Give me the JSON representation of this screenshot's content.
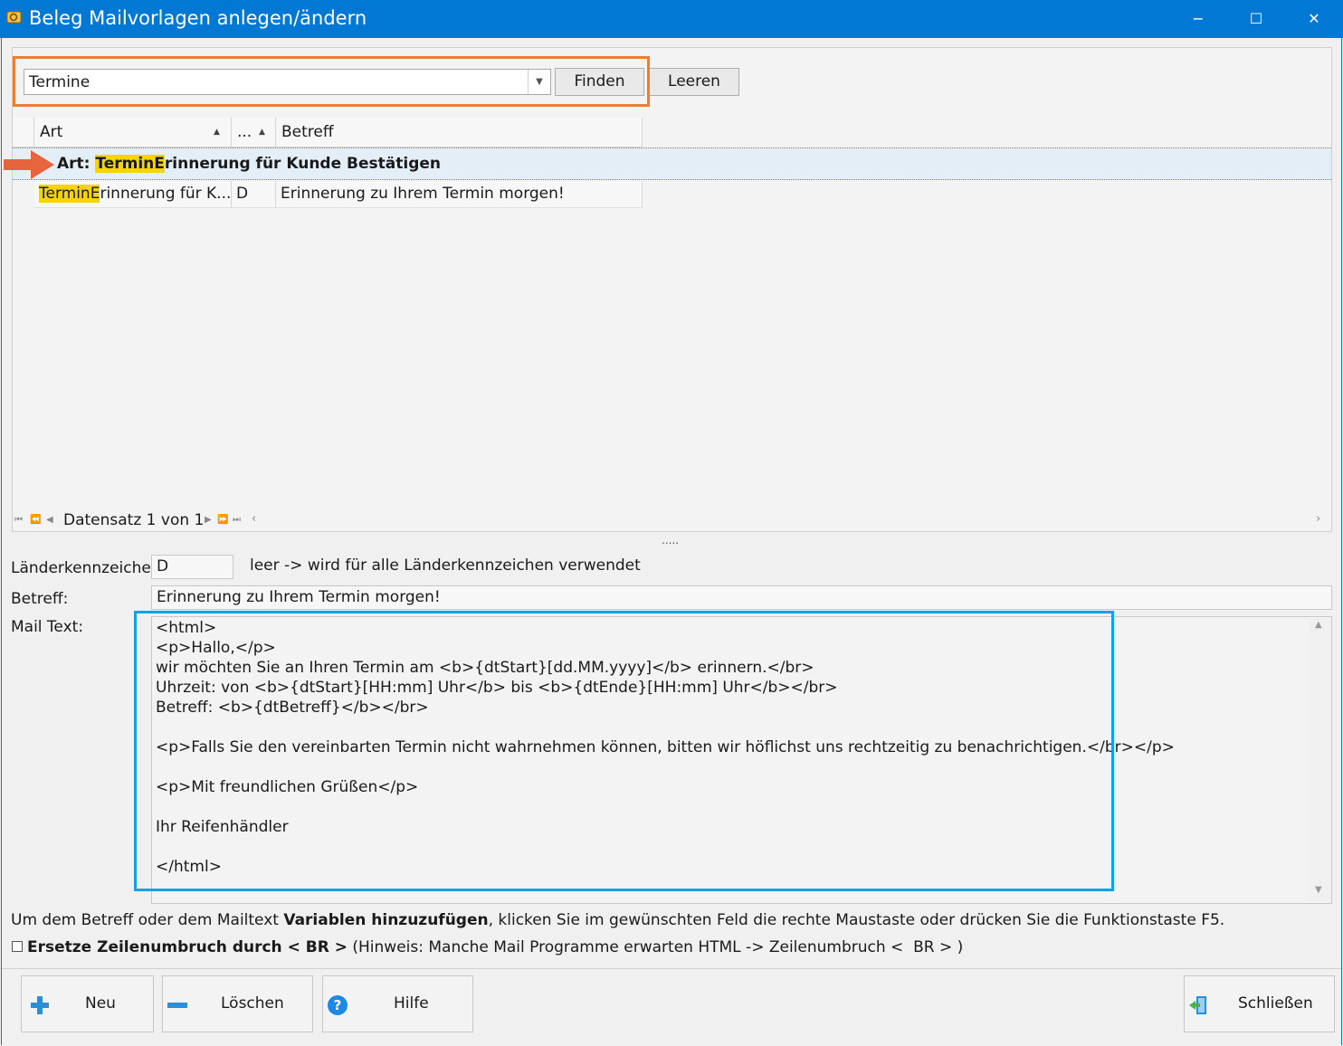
{
  "window": {
    "title": "Beleg Mailvorlagen anlegen/ändern",
    "minimize": "−",
    "maximize": "☐",
    "close": "✕"
  },
  "search": {
    "value": "Termine",
    "find_label": "Finden",
    "clear_label": "Leeren"
  },
  "grid": {
    "columns": [
      {
        "label": "Art"
      },
      {
        "label": "..."
      },
      {
        "label": "Betreff"
      }
    ],
    "group": {
      "prefix": "Art: ",
      "highlight_a": "Termin",
      "highlight_b": "E",
      "rest": "rinnerung für Kunde Bestätigen"
    },
    "row": {
      "art_highlight_a": "Termin",
      "art_highlight_b": "E",
      "art_rest": "rinnerung für K...",
      "code": "D",
      "betreff": "Erinnerung zu Ihrem Termin morgen!"
    },
    "navigator_text": "Datensatz 1 von 1"
  },
  "splitter": ".....",
  "form": {
    "country_label": "Länderkennzeichen",
    "country_value": "D",
    "country_hint": "leer -> wird für alle Länderkennzeichen verwendet",
    "subject_label": "Betreff:",
    "subject_value": "Erinnerung zu Ihrem Termin morgen!",
    "mail_label": "Mail Text:",
    "mail_lines": [
      "<html>",
      "<p>Hallo,</p>",
      "wir möchten Sie an Ihren Termin am <b>{dtStart}[dd.MM.yyyy]</b> erinnern.</br>",
      "Uhrzeit: von <b>{dtStart}[HH:mm] Uhr</b> bis <b>{dtEnde}[HH:mm] Uhr</b></br>",
      "Betreff: <b>{dtBetreff}</b></br>",
      "",
      "<p>Falls Sie den vereinbarten Termin nicht wahrnehmen können, bitten wir höflichst uns rechtzeitig zu benachrichtigen.</br></p>",
      "",
      "<p>Mit freundlichen Grüßen</p>",
      "",
      "Ihr Reifenhändler",
      "",
      "</html>"
    ]
  },
  "info": {
    "part1": "Um dem Betreff oder dem Mailtext ",
    "part2": "Variablen hinzuzufügen",
    "part3": ", klicken Sie im gewünschten Feld die rechte Maustaste oder drücken Sie die Funktionstaste F5."
  },
  "checkbox": {
    "bold_label": "Ersetze Zeilenumbruch durch < BR >",
    "hint": " (Hinweis: Manche Mail Programme erwarten HTML -> Zeilenumbruch <  BR > )"
  },
  "buttons": {
    "new": "Neu",
    "delete": "Löschen",
    "help": "Hilfe",
    "close": "Schließen"
  },
  "colors": {
    "titlebar": "#0078d4",
    "orange_frame": "#ed7d31",
    "blue_frame": "#12a2e3",
    "highlight": "#f5d400",
    "arrow": "#e8643c"
  }
}
